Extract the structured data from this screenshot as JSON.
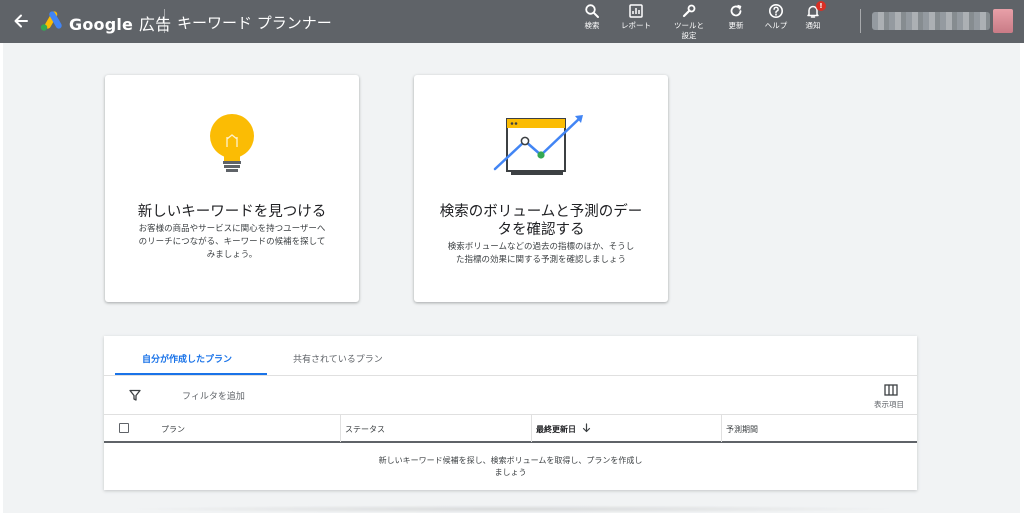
{
  "header": {
    "brand_main": "Google",
    "brand_sub": "広告",
    "tool_name": "キーワード プランナー",
    "actions": [
      {
        "label": "検索",
        "icon": "search-icon"
      },
      {
        "label": "レポート",
        "icon": "report-icon"
      },
      {
        "label_1": "ツールと",
        "label_2": "設定",
        "icon": "wrench-icon"
      },
      {
        "label": "更新",
        "icon": "refresh-icon"
      },
      {
        "label": "ヘルプ",
        "icon": "help-icon"
      },
      {
        "label": "通知",
        "icon": "bell-icon",
        "badge": "!"
      }
    ]
  },
  "cards": [
    {
      "title": "新しいキーワードを見つける",
      "desc_lines": [
        "お客様の商品やサービスに関心を持つユーザーへ",
        "のリーチにつながる、キーワードの候補を探して",
        "みましょう。"
      ],
      "icon": "lightbulb-icon"
    },
    {
      "title_lines": [
        "検索のボリュームと予測のデー",
        "タを確認する"
      ],
      "desc_lines": [
        "検索ボリュームなどの過去の指標のほか、そうし",
        "た指標の効果に関する予測を確認しましょう"
      ],
      "icon": "trend-chart-icon"
    }
  ],
  "plans": {
    "tabs": [
      "自分が作成したプラン",
      "共有されているプラン"
    ],
    "active_tab": 0,
    "filter_label": "フィルタを追加",
    "columns_label": "表示項目",
    "headers": [
      "プラン",
      "ステータス",
      "最終更新日",
      "予測期間"
    ],
    "sorted_column": "最終更新日",
    "empty_lines": [
      "新しいキーワード候補を探し、検索ボリュームを取得し、プランを作成し",
      "ましょう"
    ]
  },
  "colors": {
    "topbar": "#5f6368",
    "accent": "#1a73e8",
    "background": "#f1f3f4",
    "bulb": "#fbbc04",
    "trend_line": "#4285f4",
    "point": "#34a853",
    "badge": "#d93025"
  }
}
